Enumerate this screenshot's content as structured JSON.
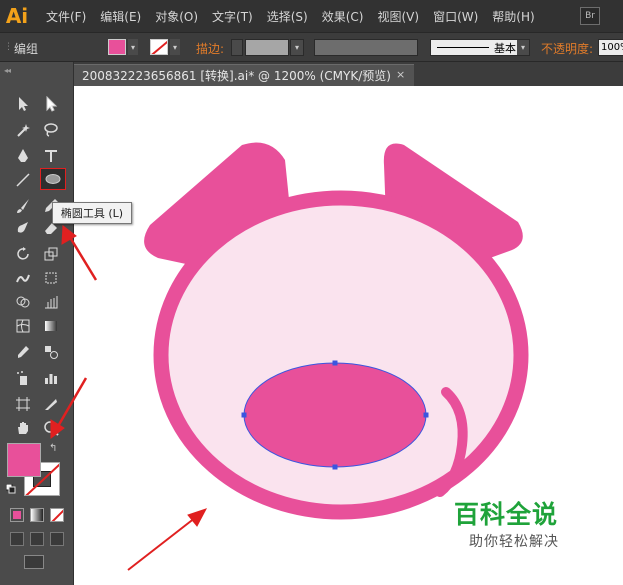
{
  "app": {
    "logo_text": "Ai",
    "bridge_icon_text": "Br"
  },
  "menu": {
    "items": [
      "文件(F)",
      "编辑(E)",
      "对象(O)",
      "文字(T)",
      "选择(S)",
      "效果(C)",
      "视图(V)",
      "窗口(W)",
      "帮助(H)"
    ]
  },
  "control_bar": {
    "selection_label": "编组",
    "stroke_label": "描边:",
    "brush_label": "基本",
    "opacity_label": "不透明度:",
    "opacity_value": "100%"
  },
  "document": {
    "tab_title": "200832223656861 [转换].ai* @ 1200% (CMYK/预览)",
    "close_glyph": "×"
  },
  "tooltip": {
    "text": "椭圆工具 (L)"
  },
  "colors": {
    "fill": "#e8509a",
    "pig_body": "#fae3ee",
    "selection_outline": "#3a56e0",
    "annotation_arrow": "#e02020"
  },
  "tools": [
    "selection-tool",
    "direct-selection-tool",
    "magic-wand-tool",
    "lasso-tool",
    "pen-tool",
    "type-tool",
    "line-segment-tool",
    "ellipse-tool",
    "paintbrush-tool",
    "pencil-tool",
    "blob-brush-tool",
    "eraser-tool",
    "rotate-tool",
    "scale-tool",
    "warp-tool",
    "free-transform-tool",
    "shape-builder-tool",
    "perspective-grid-tool",
    "mesh-tool",
    "gradient-tool",
    "eyedropper-tool",
    "blend-tool",
    "symbol-sprayer-tool",
    "column-graph-tool",
    "artboard-tool",
    "slice-tool",
    "hand-tool",
    "zoom-tool"
  ],
  "watermark": {
    "title": "百科全说",
    "subtitle": "助你轻松解决"
  }
}
